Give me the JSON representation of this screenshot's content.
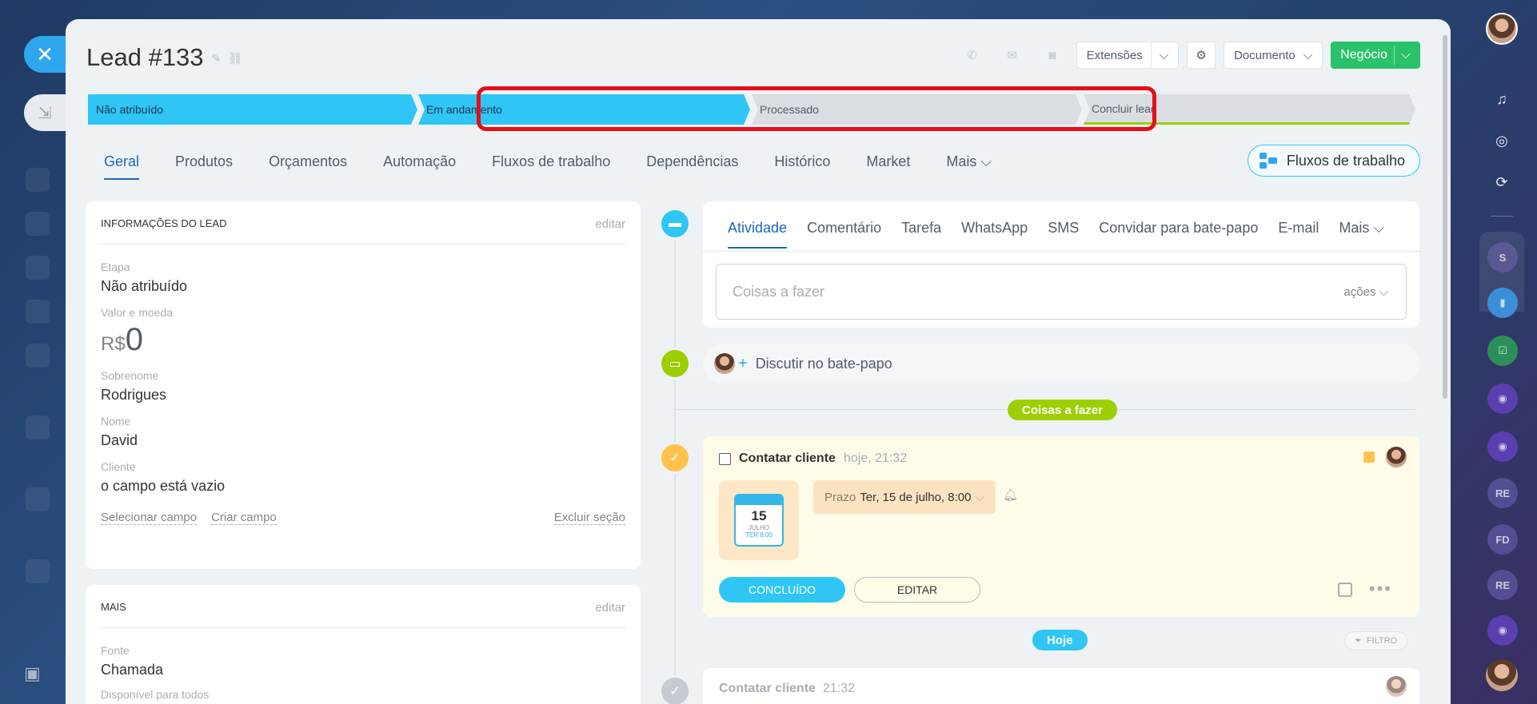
{
  "header": {
    "title": "Lead #133",
    "extensions_label": "Extensões",
    "document_label": "Documento",
    "deal_label": "Negócio"
  },
  "stages": [
    {
      "label": "Não atribuído",
      "state": "done",
      "color": "#2fc6f6"
    },
    {
      "label": "Em andamento",
      "state": "done",
      "color": "#2fc6f6"
    },
    {
      "label": "Processado",
      "state": "pending",
      "color": "#dadde1"
    },
    {
      "label": "Concluir lead",
      "state": "final",
      "color": "#dadde1"
    }
  ],
  "tabs": [
    {
      "label": "Geral",
      "active": true
    },
    {
      "label": "Produtos"
    },
    {
      "label": "Orçamentos"
    },
    {
      "label": "Automação"
    },
    {
      "label": "Fluxos de trabalho"
    },
    {
      "label": "Dependências"
    },
    {
      "label": "Histórico"
    },
    {
      "label": "Market"
    },
    {
      "label": "Mais"
    }
  ],
  "workflow_button": "Fluxos de trabalho",
  "lead_info": {
    "heading": "INFORMAÇÕES DO LEAD",
    "edit": "editar",
    "stage_label": "Etapa",
    "stage_value": "Não atribuído",
    "amount_label": "Valor e moeda",
    "currency": "R$",
    "amount": "0",
    "surname_label": "Sobrenome",
    "surname_value": "Rodrigues",
    "name_label": "Nome",
    "name_value": "David",
    "client_label": "Cliente",
    "client_value": "o campo está vazio",
    "select_field": "Selecionar campo",
    "create_field": "Criar campo",
    "delete_section": "Excluir seção"
  },
  "more_info": {
    "heading": "MAIS",
    "edit": "editar",
    "source_label": "Fonte",
    "source_value": "Chamada",
    "available_label": "Disponível para todos"
  },
  "activity": {
    "tabs": [
      "Atividade",
      "Comentário",
      "Tarefa",
      "WhatsApp",
      "SMS",
      "Convidar para bate-papo",
      "E-mail",
      "Mais"
    ],
    "placeholder": "Coisas a fazer",
    "actions": "ações"
  },
  "chat_row": "Discutir no bate-papo",
  "todo_pill": "Coisas a fazer",
  "task": {
    "title": "Contatar cliente",
    "time": "hoje, 21:32",
    "cal_day": "15",
    "cal_month": "JULHO",
    "cal_week": "TER 8:00",
    "deadline_label": "Prazo",
    "deadline_value": "Ter, 15 de julho, 8:00",
    "done_button": "CONCLUÍDO",
    "edit_button": "EDITAR"
  },
  "today_pill": "Hoje",
  "filter_label": "FILTRO",
  "task2": {
    "title": "Contatar cliente",
    "time": "21:32"
  },
  "right_sidebar": {
    "badges": [
      "S",
      "RE",
      "FD",
      "RE"
    ]
  },
  "colors": {
    "accent": "#2fc6f6",
    "link": "#2067b0",
    "green": "#29c26a",
    "highlight": "#e50e17"
  }
}
